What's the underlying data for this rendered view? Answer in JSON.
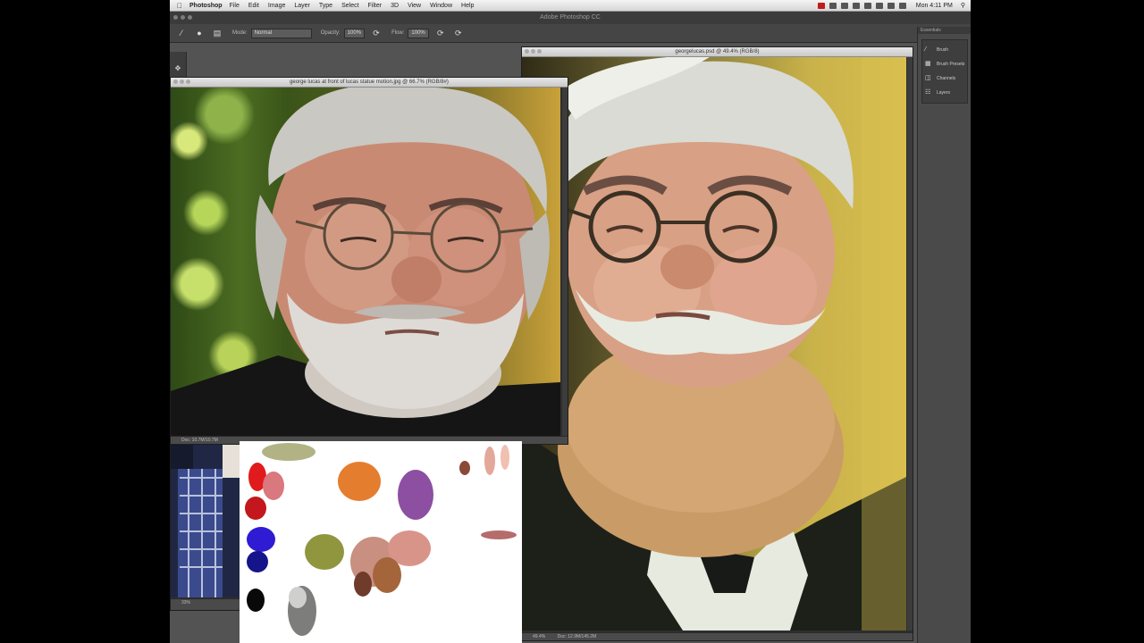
{
  "menubar": {
    "app_name": "Photoshop",
    "menus": [
      "File",
      "Edit",
      "Image",
      "Layer",
      "Type",
      "Select",
      "Filter",
      "3D",
      "View",
      "Window",
      "Help"
    ],
    "clock": "Mon 4:11 PM"
  },
  "app_title": "Adobe Photoshop CC",
  "options_bar": {
    "mode_label": "Mode:",
    "mode_value": "Normal",
    "opacity_label": "Opacity:",
    "opacity_value": "100%",
    "flow_label": "Flow:",
    "flow_value": "100%"
  },
  "right_panel": {
    "header": "Essentials",
    "items": [
      {
        "label": "Brush",
        "icon": "brush-icon"
      },
      {
        "label": "Brush Presets",
        "icon": "brush-presets-icon"
      },
      {
        "label": "Channels",
        "icon": "channels-icon"
      },
      {
        "label": "Layers",
        "icon": "layers-icon"
      }
    ]
  },
  "documents": {
    "photo": {
      "title": "george lucas at front of lucas statue motion.jpg @ 66.7% (RGB/8#)",
      "status": "Doc: 10.7M/10.7M"
    },
    "painting": {
      "title": "georgelucas.psd @ 49.4% (RGB/8)",
      "zoom": "49.4%",
      "status": "Doc: 12.9M/145.2M"
    },
    "small": {
      "zoom": "33%"
    }
  },
  "colors": {
    "foreground": "#f2c9c3",
    "background": "#ffffff"
  }
}
